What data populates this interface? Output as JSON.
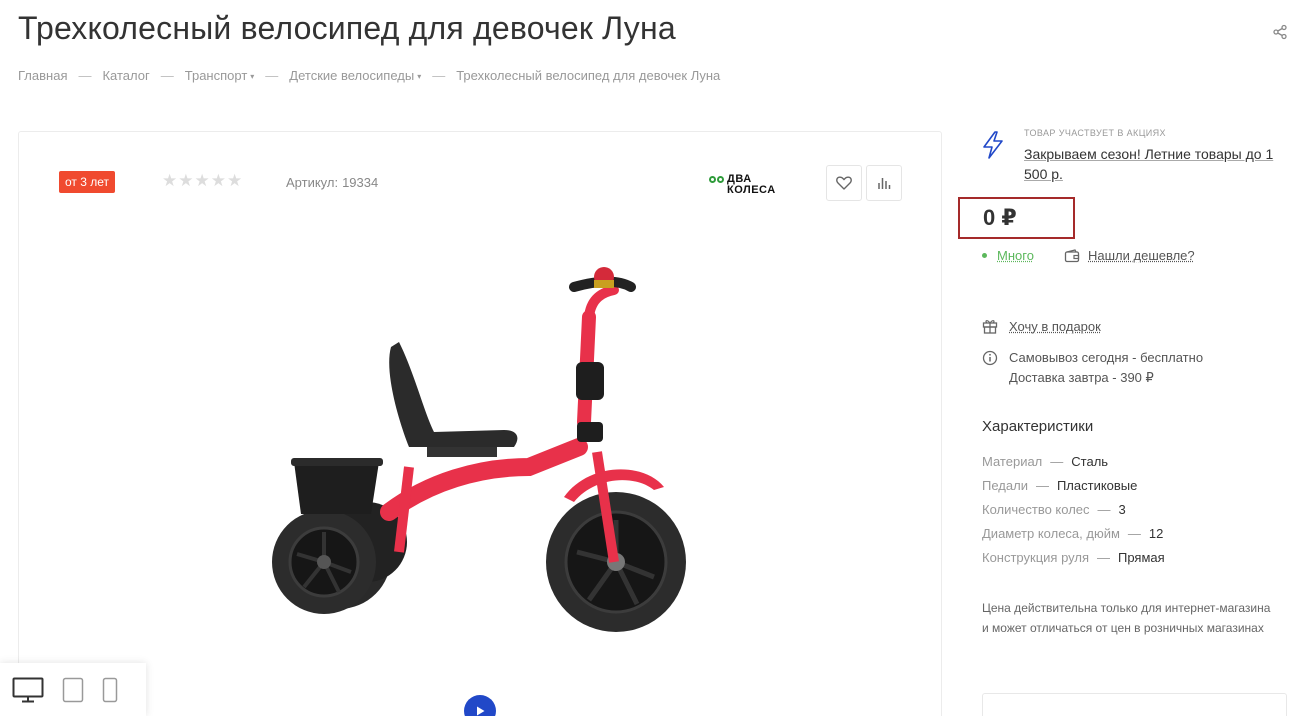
{
  "page": {
    "title": "Трехколесный велосипед для девочек Луна"
  },
  "breadcrumb": {
    "items": [
      "Главная",
      "Каталог",
      "Транспорт",
      "Детские велосипеды",
      "Трехколесный велосипед для девочек Луна"
    ],
    "separator": "—",
    "dropdown_caret": "▾"
  },
  "product": {
    "age_badge": "от 3 лет",
    "rating_stars": [
      "★",
      "★",
      "★",
      "★",
      "★"
    ],
    "rating_value": 0,
    "sku_label": "Артикул:",
    "sku_value": "19334",
    "brand_line1": "ДВА",
    "brand_line2": "КОЛЕСА",
    "image_alt": "Трехколесный велосипед красный"
  },
  "promo": {
    "caption": "Товар участвует в акциях",
    "link": "Закрываем сезон! Летние товары до 1 500 р."
  },
  "price": {
    "value": "0 ₽"
  },
  "stock": {
    "label": "Много",
    "cheaper": "Нашли дешевле?"
  },
  "gift": {
    "label": "Хочу в подарок"
  },
  "delivery": {
    "pickup": "Самовывоз сегодня - бесплатно",
    "courier": "Доставка завтра - 390 ₽"
  },
  "specs": {
    "title": "Характеристики",
    "dash": "—",
    "rows": [
      {
        "key": "Материал",
        "value": "Сталь"
      },
      {
        "key": "Педали",
        "value": "Пластиковые"
      },
      {
        "key": "Количество колес",
        "value": "3"
      },
      {
        "key": "Диаметр колеса, дюйм",
        "value": "12"
      },
      {
        "key": "Конструкция руля",
        "value": "Прямая"
      }
    ]
  },
  "note": "Цена действительна только для интернет-магазина и может отличаться от цен в розничных магазинах",
  "colors": {
    "badge": "#f04a2f",
    "price_border": "#a52a2a",
    "in_stock": "#5cb85c",
    "play_button": "#2148c8",
    "bike_frame": "#e8314a",
    "promo_icon": "#2148c8"
  },
  "icons": {
    "share": "share-icon",
    "favorite": "heart-icon",
    "compare": "bar-chart-icon",
    "promo": "lightning-icon",
    "cheaper": "wallet-icon",
    "gift": "gift-icon",
    "info": "info-icon",
    "play": "play-icon",
    "desktop": "desktop-icon",
    "tablet": "tablet-icon",
    "mobile": "mobile-icon"
  }
}
